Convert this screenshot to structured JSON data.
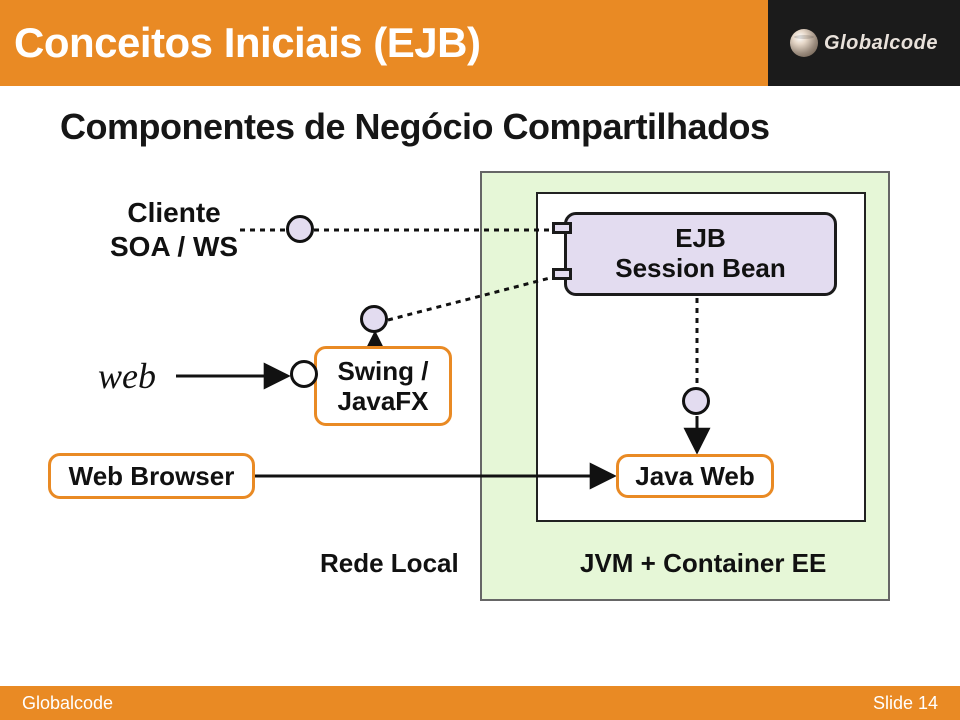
{
  "header": {
    "title": "Conceitos Iniciais (EJB)",
    "logo_text": "Globalcode"
  },
  "subtitle": "Componentes de Negócio Compartilhados",
  "labels": {
    "cliente_l1": "Cliente",
    "cliente_l2": "SOA / WS",
    "web": "web",
    "browser": "Web Browser",
    "swing_l1": "Swing /",
    "swing_l2": "JavaFX",
    "ejb_l1": "EJB",
    "ejb_l2": "Session Bean",
    "javaweb": "Java Web",
    "rede": "Rede Local",
    "jvm": "JVM + Container EE"
  },
  "footer": {
    "left": "Globalcode",
    "right_prefix": "Slide ",
    "right_num": "14"
  },
  "colors": {
    "accent": "#e98a24",
    "container_fill": "#e6f7d7",
    "ejb_fill": "#e3dcf0"
  }
}
